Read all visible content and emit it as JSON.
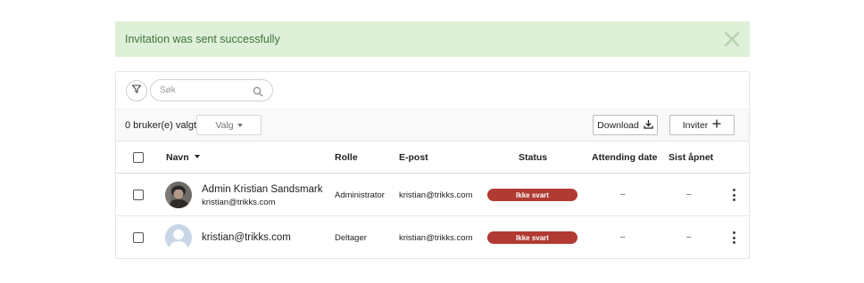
{
  "alert": {
    "message": "Invitation was sent successfully",
    "close_icon": "close-icon",
    "colors": {
      "background": "#dff0d8",
      "text": "#3c763d"
    }
  },
  "filter": {
    "icon": "filter-icon"
  },
  "search": {
    "placeholder": "Søk",
    "value": "",
    "icon": "search-icon"
  },
  "toolbar": {
    "selected_count": "0 bruker(e) valgt",
    "valg_label": "Valg",
    "download_label": "Download",
    "invite_label": "Inviter",
    "download_icon": "download-icon",
    "invite_icon": "plus-icon"
  },
  "table": {
    "columns": {
      "name": "Navn",
      "role": "Rolle",
      "email": "E-post",
      "status": "Status",
      "attending": "Attending date",
      "last_opened": "Sist åpnet"
    },
    "rows": [
      {
        "name": "Admin Kristian Sandsmark",
        "sub": "kristian@trikks.com",
        "role": "Administrator",
        "email": "kristian@trikks.com",
        "status": "Ikke svart",
        "attending": "–",
        "last_opened": "–",
        "avatar": "user-photo"
      },
      {
        "name": "kristian@trikks.com",
        "sub": "",
        "role": "Deltager",
        "email": "kristian@trikks.com",
        "status": "Ikke svart",
        "attending": "–",
        "last_opened": "–",
        "avatar": "default-avatar"
      }
    ],
    "status_color": "#b13a32"
  }
}
